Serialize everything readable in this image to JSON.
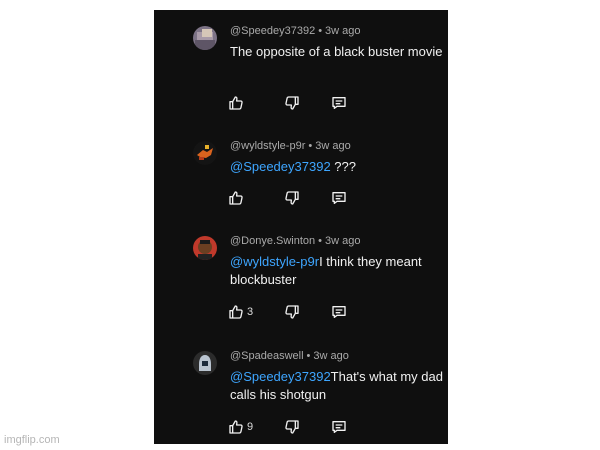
{
  "watermark": "imgflip.com",
  "comments": [
    {
      "author": "@Speedey37392",
      "age": "3w ago",
      "mention": "",
      "text": "The opposite of a black buster movie",
      "likes": "",
      "avatar_icon": "avatar-icon",
      "avatar_color": "#8a7f8f"
    },
    {
      "author": "@wyldstyle-p9r",
      "age": "3w ago",
      "mention": "@Speedey37392",
      "text": " ???",
      "likes": "",
      "avatar_icon": "avatar-icon",
      "avatar_color": "#1a1a1a"
    },
    {
      "author": "@Donye.Swinton",
      "age": "3w ago",
      "mention": "@wyldstyle-p9r",
      "text": "I think they meant blockbuster",
      "likes": "3",
      "avatar_icon": "avatar-icon",
      "avatar_color": "#c0392b"
    },
    {
      "author": "@Spadeaswell",
      "age": "3w ago",
      "mention": "@Speedey37392",
      "text": "That's what my dad calls his shotgun",
      "likes": "9",
      "avatar_icon": "avatar-icon",
      "avatar_color": "#2b2b2b"
    }
  ],
  "icons": {
    "like": "thumbs-up-icon",
    "dislike": "thumbs-down-icon",
    "reply": "reply-icon",
    "separator": "•"
  },
  "colors": {
    "background": "#0f0f0f",
    "mention": "#3ea6ff",
    "text": "#f1f1f1",
    "meta": "#aaaaaa"
  }
}
